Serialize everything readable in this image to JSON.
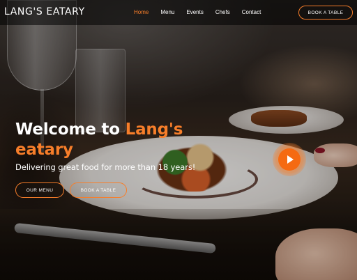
{
  "brand": {
    "name": "LANG'S EATARY"
  },
  "nav": {
    "items": [
      {
        "label": "Home",
        "active": true
      },
      {
        "label": "Menu",
        "active": false
      },
      {
        "label": "Events",
        "active": false
      },
      {
        "label": "Chefs",
        "active": false
      },
      {
        "label": "Contact",
        "active": false
      }
    ],
    "book_label": "BOOK A TABLE"
  },
  "hero": {
    "title_part1": "Welcome to ",
    "title_accent": "Lang's eatary",
    "subtitle": "Delivering great food for more than 18 years!",
    "buttons": {
      "menu_label": "OUR MENU",
      "book_label": "BOOK A TABLE"
    },
    "play_icon": "play-icon"
  },
  "colors": {
    "accent": "#f77e2a",
    "text": "#ffffff",
    "header_bg": "rgba(0,0,0,0.55)"
  }
}
